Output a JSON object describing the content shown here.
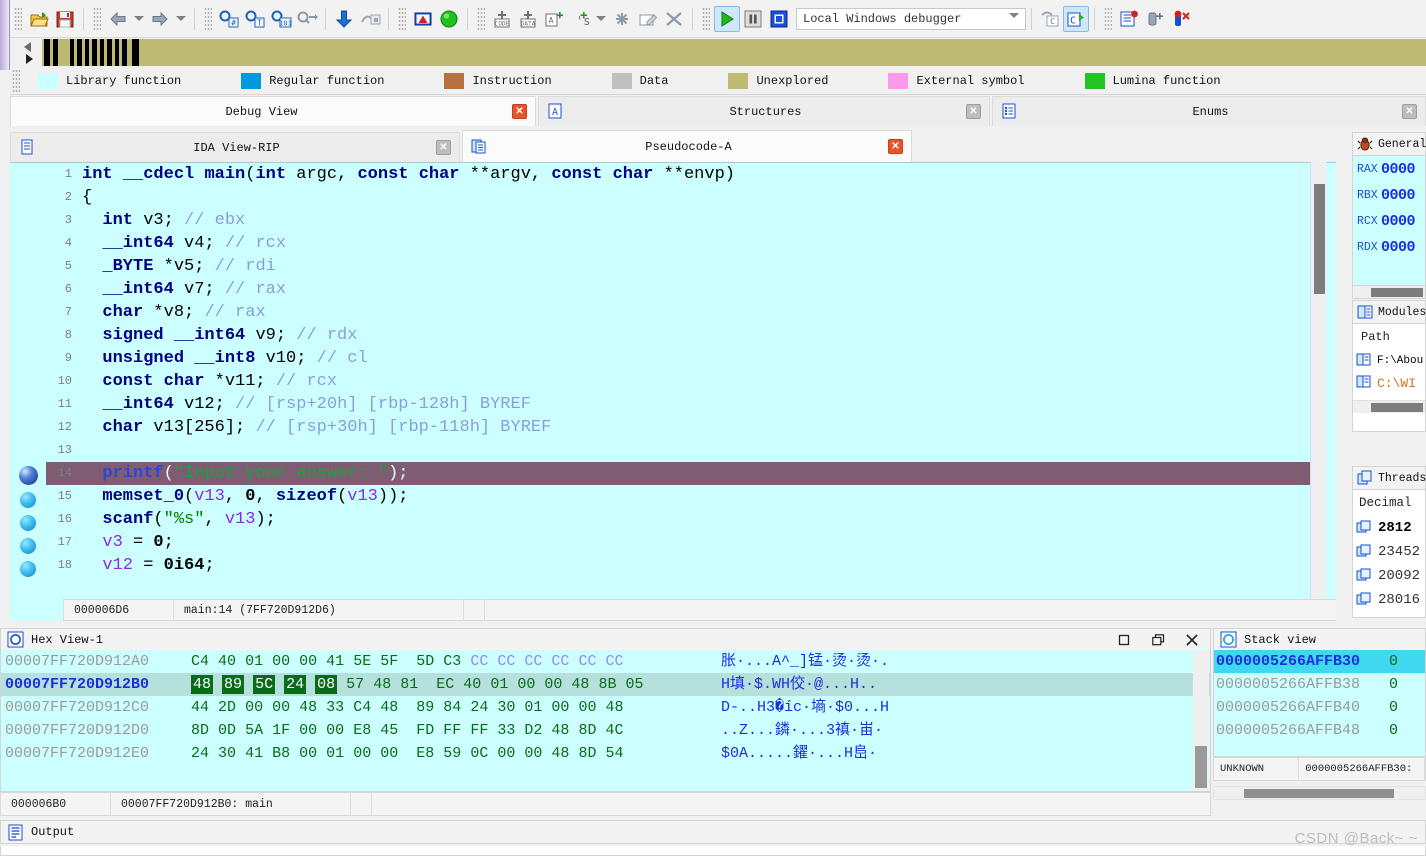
{
  "toolbar": {
    "buttons": [
      {
        "name": "open-icon",
        "title": "Open"
      },
      {
        "name": "save-icon",
        "title": "Save"
      },
      {
        "name": "back-arrow-icon",
        "title": "Jump back"
      },
      {
        "name": "back-dropdown-icon",
        "title": "Jump back list"
      },
      {
        "name": "forward-arrow-icon",
        "title": "Jump forward"
      },
      {
        "name": "forward-dropdown-icon",
        "title": "Jump forward list"
      },
      {
        "name": "search-hash-icon",
        "title": "Search next code"
      },
      {
        "name": "search-text-icon",
        "title": "Search text"
      },
      {
        "name": "search-sequence-icon",
        "title": "Search sequence of bytes"
      },
      {
        "name": "binary-search-icon",
        "title": "Binary search"
      },
      {
        "name": "jump-down-icon",
        "title": "Jump to address"
      },
      {
        "name": "no-jump-icon",
        "title": "Jump disabled"
      },
      {
        "name": "warning-icon",
        "title": "Problems"
      },
      {
        "name": "green-circle-icon",
        "title": "Function ok"
      },
      {
        "name": "make-code-icon",
        "title": "Make code"
      },
      {
        "name": "make-data-icon",
        "title": "Make data"
      },
      {
        "name": "make-array-icon",
        "title": "Make array"
      },
      {
        "name": "make-string-icon",
        "title": "Make string"
      },
      {
        "name": "make-string-dropdown-icon",
        "title": "String type"
      },
      {
        "name": "undefine-icon",
        "title": "Undefine"
      },
      {
        "name": "edit-function-icon",
        "title": "Edit function"
      },
      {
        "name": "delete-function-icon",
        "title": "Delete function"
      },
      {
        "name": "run-icon",
        "title": "Start process"
      },
      {
        "name": "pause-icon",
        "title": "Pause process"
      },
      {
        "name": "stop-icon",
        "title": "Terminate process"
      },
      {
        "name": "step-over-source-icon",
        "title": "Step over source line"
      },
      {
        "name": "step-into-source-icon",
        "title": "Step into source line"
      },
      {
        "name": "breakpoint-list-icon",
        "title": "Breakpoint list"
      },
      {
        "name": "add-breakpoint-icon",
        "title": "Add breakpoint"
      },
      {
        "name": "delete-breakpoint-icon",
        "title": "Delete breakpoint"
      }
    ],
    "debugger_select": {
      "value": "Local Windows debugger",
      "placeholder": "Local Windows debugger"
    }
  },
  "legend": {
    "items": [
      {
        "label": "Library function",
        "color": "#c8ffff"
      },
      {
        "label": "Regular function",
        "color": "#0099e0"
      },
      {
        "label": "Instruction",
        "color": "#b5713f"
      },
      {
        "label": "Data",
        "color": "#c0c0c0"
      },
      {
        "label": "Unexplored",
        "color": "#bfba73"
      },
      {
        "label": "External symbol",
        "color": "#ff99ee"
      },
      {
        "label": "Lumina function",
        "color": "#22c322"
      }
    ]
  },
  "tabs_top": [
    {
      "label": "Debug View",
      "active": true,
      "close": "red",
      "icon": null
    },
    {
      "label": "Structures",
      "active": false,
      "close": "gray",
      "icon": "structures-icon"
    },
    {
      "label": "Enums",
      "active": false,
      "close": "gray",
      "icon": "enums-icon"
    }
  ],
  "tabs_second": [
    {
      "label": "IDA View-RIP",
      "active": false,
      "close": "gray",
      "icon": "ida-view-icon"
    },
    {
      "label": "Pseudocode-A",
      "active": true,
      "close": "red",
      "icon": "pseudocode-icon"
    }
  ],
  "pseudocode": {
    "lines": [
      {
        "n": "1",
        "segments": [
          {
            "t": "int ",
            "c": "kw"
          },
          {
            "t": "__cdecl ",
            "c": "kw"
          },
          {
            "t": "main",
            "c": "fn"
          },
          {
            "t": "(",
            "c": "id"
          },
          {
            "t": "int ",
            "c": "kw"
          },
          {
            "t": "argc, ",
            "c": "id"
          },
          {
            "t": "const ",
            "c": "kw"
          },
          {
            "t": "char ",
            "c": "kw"
          },
          {
            "t": "**argv, ",
            "c": "id"
          },
          {
            "t": "const ",
            "c": "kw"
          },
          {
            "t": "char ",
            "c": "kw"
          },
          {
            "t": "**envp)",
            "c": "id"
          }
        ]
      },
      {
        "n": "2",
        "segments": [
          {
            "t": "{",
            "c": "id"
          }
        ]
      },
      {
        "n": "3",
        "segments": [
          {
            "t": "  int ",
            "c": "kw"
          },
          {
            "t": "v3; ",
            "c": "id"
          },
          {
            "t": "// ebx",
            "c": "cmt"
          }
        ]
      },
      {
        "n": "4",
        "segments": [
          {
            "t": "  __int64 ",
            "c": "kw"
          },
          {
            "t": "v4; ",
            "c": "id"
          },
          {
            "t": "// rcx",
            "c": "cmt"
          }
        ]
      },
      {
        "n": "5",
        "segments": [
          {
            "t": "  _BYTE ",
            "c": "kw"
          },
          {
            "t": "*v5; ",
            "c": "id"
          },
          {
            "t": "// rdi",
            "c": "cmt"
          }
        ]
      },
      {
        "n": "6",
        "segments": [
          {
            "t": "  __int64 ",
            "c": "kw"
          },
          {
            "t": "v7; ",
            "c": "id"
          },
          {
            "t": "// rax",
            "c": "cmt"
          }
        ]
      },
      {
        "n": "7",
        "segments": [
          {
            "t": "  char ",
            "c": "kw"
          },
          {
            "t": "*v8; ",
            "c": "id"
          },
          {
            "t": "// rax",
            "c": "cmt"
          }
        ]
      },
      {
        "n": "8",
        "segments": [
          {
            "t": "  signed __int64 ",
            "c": "kw"
          },
          {
            "t": "v9; ",
            "c": "id"
          },
          {
            "t": "// rdx",
            "c": "cmt"
          }
        ]
      },
      {
        "n": "9",
        "segments": [
          {
            "t": "  unsigned __int8 ",
            "c": "kw"
          },
          {
            "t": "v10; ",
            "c": "id"
          },
          {
            "t": "// cl",
            "c": "cmt"
          }
        ]
      },
      {
        "n": "10",
        "segments": [
          {
            "t": "  const char ",
            "c": "kw"
          },
          {
            "t": "*v11; ",
            "c": "id"
          },
          {
            "t": "// rcx",
            "c": "cmt"
          }
        ]
      },
      {
        "n": "11",
        "segments": [
          {
            "t": "  __int64 ",
            "c": "kw"
          },
          {
            "t": "v12; ",
            "c": "id"
          },
          {
            "t": "// [rsp+20h] [rbp-128h] BYREF",
            "c": "cmt"
          }
        ]
      },
      {
        "n": "12",
        "segments": [
          {
            "t": "  char ",
            "c": "kw"
          },
          {
            "t": "v13[256]; ",
            "c": "id"
          },
          {
            "t": "// [rsp+30h] [rbp-118h] BYREF",
            "c": "cmt"
          }
        ]
      },
      {
        "n": "13",
        "segments": []
      },
      {
        "n": "14",
        "highlight": true,
        "bp": "current",
        "segments": [
          {
            "t": "  printf",
            "c": "fn"
          },
          {
            "t": "(",
            "c": "id"
          },
          {
            "t": "\"Input your answer: \"",
            "c": "str"
          },
          {
            "t": ");",
            "c": "id"
          }
        ]
      },
      {
        "n": "15",
        "bp": "enabled",
        "segments": [
          {
            "t": "  memset_0",
            "c": "fn"
          },
          {
            "t": "(",
            "c": "id"
          },
          {
            "t": "v13",
            "c": "var"
          },
          {
            "t": ", ",
            "c": "id"
          },
          {
            "t": "0",
            "c": "num"
          },
          {
            "t": ", ",
            "c": "id"
          },
          {
            "t": "sizeof",
            "c": "kw"
          },
          {
            "t": "(",
            "c": "id"
          },
          {
            "t": "v13",
            "c": "var"
          },
          {
            "t": "));",
            "c": "id"
          }
        ]
      },
      {
        "n": "16",
        "bp": "enabled",
        "segments": [
          {
            "t": "  scanf",
            "c": "fn"
          },
          {
            "t": "(",
            "c": "id"
          },
          {
            "t": "\"%s\"",
            "c": "str"
          },
          {
            "t": ", ",
            "c": "id"
          },
          {
            "t": "v13",
            "c": "var"
          },
          {
            "t": ");",
            "c": "id"
          }
        ]
      },
      {
        "n": "17",
        "bp": "enabled",
        "segments": [
          {
            "t": "  ",
            "c": "id"
          },
          {
            "t": "v3",
            "c": "var"
          },
          {
            "t": " = ",
            "c": "id"
          },
          {
            "t": "0",
            "c": "num"
          },
          {
            "t": ";",
            "c": "id"
          }
        ]
      },
      {
        "n": "18",
        "bp": "enabled",
        "segments": [
          {
            "t": "  ",
            "c": "id"
          },
          {
            "t": "v12",
            "c": "var"
          },
          {
            "t": " = ",
            "c": "id"
          },
          {
            "t": "0i64",
            "c": "num"
          },
          {
            "t": ";",
            "c": "id"
          }
        ]
      }
    ],
    "status": {
      "offset": "000006D6",
      "location": "main:14 (7FF720D912D6)"
    }
  },
  "registers_panel": {
    "title": "General",
    "rows": [
      {
        "name": "RAX",
        "value": "0000"
      },
      {
        "name": "RBX",
        "value": "0000"
      },
      {
        "name": "RCX",
        "value": "0000"
      },
      {
        "name": "RDX",
        "value": "0000"
      }
    ]
  },
  "modules_panel": {
    "title": "Modules",
    "column": "Path",
    "rows": [
      {
        "path": "F:\\Abou",
        "highlight": false
      },
      {
        "path": "C:\\WI",
        "highlight": true
      }
    ]
  },
  "threads_panel": {
    "title": "Threads",
    "column": "Decimal",
    "rows": [
      "2812",
      "23452",
      "20092",
      "28016"
    ]
  },
  "hex_view": {
    "title": "Hex View-1",
    "rows": [
      {
        "addr": "00007FF720D912A0",
        "bytes": "C4 40 01 00 00 41 5E 5F  5D C3 CC CC CC CC CC CC",
        "ascii": "胀·...A^_]锰·烫·烫·.",
        "selected": false,
        "highlight_count": 0,
        "cc_from": 10
      },
      {
        "addr": "00007FF720D912B0",
        "bytes": "48 89 5C 24 08 57 48 81  EC 40 01 00 00 48 8B 05",
        "ascii": "H填·$.WH佼·@...H..",
        "selected": true,
        "highlight_count": 5,
        "cc_from": -1
      },
      {
        "addr": "00007FF720D912C0",
        "bytes": "44 2D 00 00 48 33 C4 48  89 84 24 30 01 00 00 48",
        "ascii": "D-..H3�íc·墒·$0...H",
        "selected": false,
        "highlight_count": 0,
        "cc_from": -1
      },
      {
        "addr": "00007FF720D912D0",
        "bytes": "8D 0D 5A 1F 00 00 E8 45  FD FF FF 33 D2 48 8D 4C",
        "ascii": "..Z...鏻·...3禛·峀·",
        "selected": false,
        "highlight_count": 0,
        "cc_from": -1
      },
      {
        "addr": "00007FF720D912E0",
        "bytes": "24 30 41 B8 00 01 00 00  E8 59 0C 00 00 48 8D 54",
        "ascii": "$0A.....鑃·...H峊·",
        "selected": false,
        "highlight_count": 0,
        "cc_from": -1
      }
    ],
    "status": {
      "offset": "000006B0",
      "location": "00007FF720D912B0: main"
    },
    "window_buttons": [
      "restore",
      "maximize",
      "close"
    ]
  },
  "stack_view": {
    "title": "Stack view",
    "rows": [
      {
        "addr": "0000005266AFFB30",
        "value": "0",
        "selected": true
      },
      {
        "addr": "0000005266AFFB38",
        "value": "0",
        "selected": false
      },
      {
        "addr": "0000005266AFFB40",
        "value": "0",
        "selected": false
      },
      {
        "addr": "0000005266AFFB48",
        "value": "0",
        "selected": false
      }
    ],
    "status": {
      "segment": "UNKNOWN",
      "location": "0000005266AFFB30:"
    }
  },
  "output_panel": {
    "title": "Output"
  },
  "watermark": "CSDN @Back~ ~",
  "colors": {
    "pseudocode_bg": "#ccffff",
    "highlight_line": "#7e5c72",
    "unexplored": "#bfba73",
    "selection": "#b5e0dc",
    "stack_selection": "#3fd8f0"
  }
}
